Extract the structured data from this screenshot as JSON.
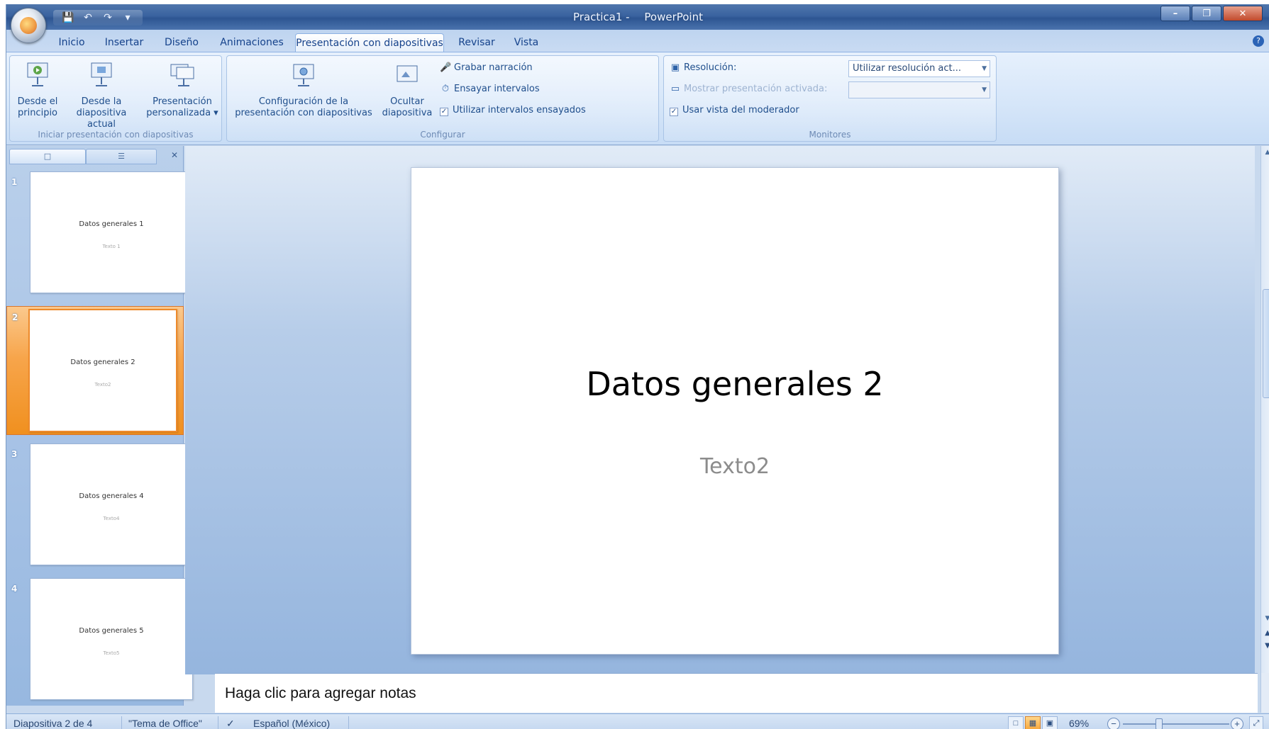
{
  "window": {
    "title_doc": "Practica1 -",
    "title_app": "PowerPoint"
  },
  "tabs": [
    "Inicio",
    "Insertar",
    "Diseño",
    "Animaciones",
    "Presentación con diapositivas",
    "Revisar",
    "Vista"
  ],
  "active_tab": "Presentación con diapositivas",
  "ribbon": {
    "group_start": {
      "label": "Iniciar presentación con diapositivas",
      "from_beginning_line1": "Desde el",
      "from_beginning_line2": "principio",
      "from_current_line1": "Desde la",
      "from_current_line2": "diapositiva actual",
      "custom_line1": "Presentación",
      "custom_line2": "personalizada"
    },
    "group_setup": {
      "label": "Configurar",
      "config_line1": "Configuración de la",
      "config_line2": "presentación con diapositivas",
      "hide_line1": "Ocultar",
      "hide_line2": "diapositiva",
      "record_narration": "Grabar narración",
      "rehearse_timings": "Ensayar intervalos",
      "use_rehearsed_timings": "Utilizar intervalos ensayados"
    },
    "group_monitors": {
      "label": "Monitores",
      "resolution_label": "Resolución:",
      "resolution_value": "Utilizar resolución act...",
      "show_on_label": "Mostrar presentación activada:",
      "presenter_view": "Usar vista del moderador"
    }
  },
  "slides": [
    {
      "num": "1",
      "title": "Datos generales 1",
      "sub": "Texto 1"
    },
    {
      "num": "2",
      "title": "Datos generales 2",
      "sub": "Texto2"
    },
    {
      "num": "3",
      "title": "Datos generales 4",
      "sub": "Texto4"
    },
    {
      "num": "4",
      "title": "Datos generales 5",
      "sub": "Texto5"
    }
  ],
  "current_slide": {
    "title": "Datos generales 2",
    "subtitle": "Texto2"
  },
  "notes_placeholder": "Haga clic para agregar notas",
  "status": {
    "slide_info": "Diapositiva 2 de 4",
    "theme": "\"Tema de Office\"",
    "language": "Español (México)",
    "zoom": "69%"
  }
}
